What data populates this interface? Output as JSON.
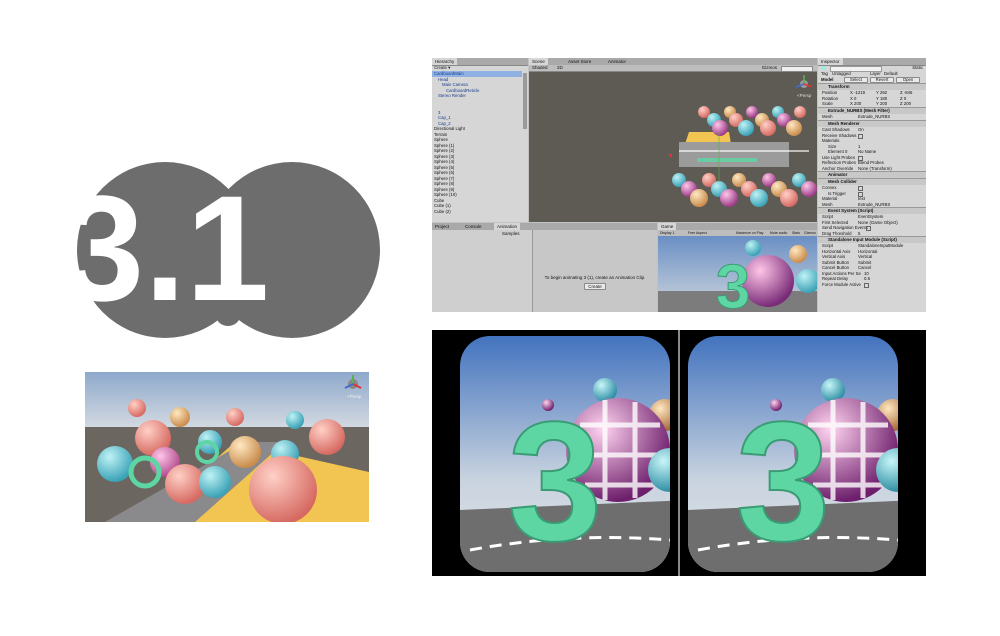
{
  "logo": {
    "text": "3.1"
  },
  "small_scene": {
    "hud_label": "<Persp"
  },
  "editor": {
    "tabs": {
      "hierarchy": "Hierarchy",
      "scene": "Scene",
      "asset_store": "Asset Store",
      "animator": "Animator",
      "inspector": "Inspector"
    },
    "scene_toolbar": {
      "shaded": "Shaded",
      "twod": "2D",
      "gizmos": "Gizmos"
    },
    "scene_persp": "<Persp",
    "hierarchy": {
      "create": "Create",
      "items": [
        "CardboardMain",
        "Head",
        "Main Camera",
        "CardboardReticle",
        "Stereo Render",
        "",
        "",
        "3",
        "Cap_1",
        "Cap_2",
        "Directional Light",
        "Terrain",
        "Sphere",
        "Sphere (1)",
        "Sphere (2)",
        "Sphere (3)",
        "Sphere (4)",
        "Sphere (5)",
        "Sphere (6)",
        "Sphere (7)",
        "Sphere (8)",
        "Sphere (9)",
        "Sphere (10)",
        "Cube",
        "Cube (1)",
        "Cube (2)"
      ]
    },
    "bottom_tabs": {
      "project": "Project",
      "console": "Console",
      "animation": "Animation"
    },
    "animation": {
      "samples": "Samples",
      "message": "To begin animating 3 (1), create an Animation Clip.",
      "create_button": "Create"
    },
    "game": {
      "tab": "Game",
      "display": "Display 1",
      "aspect": "Free Aspect",
      "maximize": "Maximize on Play",
      "mute": "Mute audio",
      "stats": "Stats",
      "gizmos": "Gizmos"
    },
    "inspector": {
      "tag_label": "Tag",
      "tag_value": "Untagged",
      "layer_label": "Layer",
      "layer_value": "Default",
      "static_label": "Static",
      "model_label": "Model",
      "select": "Select",
      "revert": "Revert",
      "open": "Open",
      "transform_title": "Transform",
      "position_label": "Position",
      "position": {
        "x": "X -1219",
        "y": "Y 292",
        "z": "Z -846"
      },
      "rotation_label": "Rotation",
      "rotation": {
        "x": "X 0",
        "y": "Y 180",
        "z": "Z 0"
      },
      "scale_label": "Scale",
      "scale": {
        "x": "X 200",
        "y": "Y 200",
        "z": "Z 200"
      },
      "mesh_filter_title": "Extrude_NURBS (Mesh Filter)",
      "mesh_label": "Mesh",
      "mesh_value": "Extrude_NURBS",
      "mesh_renderer_title": "Mesh Renderer",
      "cast_shadows": "Cast Shadows",
      "cast_shadows_value": "On",
      "receive_shadows": "Receive Shadows",
      "materials": "Materials",
      "size": "Size",
      "size_value": "1",
      "element0": "Element 0",
      "element0_value": "No Name",
      "light_probes": "Use Light Probes",
      "reflection_probes": "Reflection Probes",
      "reflection_value": "Blend Probes",
      "anchor_override": "Anchor Override",
      "anchor_value": "None (Transform)",
      "animator_title": "Animator",
      "mesh_collider_title": "Mesh Collider",
      "convex": "Convex",
      "is_trigger": "Is Trigger",
      "material_label": "Material",
      "material_value": "text",
      "collider_mesh_label": "Mesh",
      "collider_mesh_value": "Extrude_NURBS",
      "event_system_title": "Event System (Script)",
      "script_label": "Script",
      "script_value": "EventSystem",
      "first_selected": "First Selected",
      "first_selected_value": "None (Game Object)",
      "send_nav": "Send Navigation Events",
      "drag_threshold": "Drag Threshold",
      "drag_value": "5",
      "standalone_title": "Standalone Input Module (Script)",
      "standalone_script": "StandaloneInputModule",
      "horizontal_axis": "Horizontal Axis",
      "horizontal_value": "Horizontal",
      "vertical_axis": "Vertical Axis",
      "vertical_value": "Vertical",
      "submit_button": "Submit Button",
      "submit_value": "Submit",
      "cancel_button": "Cancel Button",
      "cancel_value": "Cancel",
      "input_actions": "Input Actions Per Se",
      "input_actions_value": "10",
      "repeat_delay": "Repeat Delay",
      "repeat_value": "0.5",
      "force_module": "Force Module Active"
    }
  },
  "colors": {
    "logo_gray": "#6d6d6d",
    "unity_panel": "#d6d6d6",
    "selection": "#8fb1e3",
    "scene_bg": "#5e5a54",
    "mint": "#5ed6a4"
  }
}
